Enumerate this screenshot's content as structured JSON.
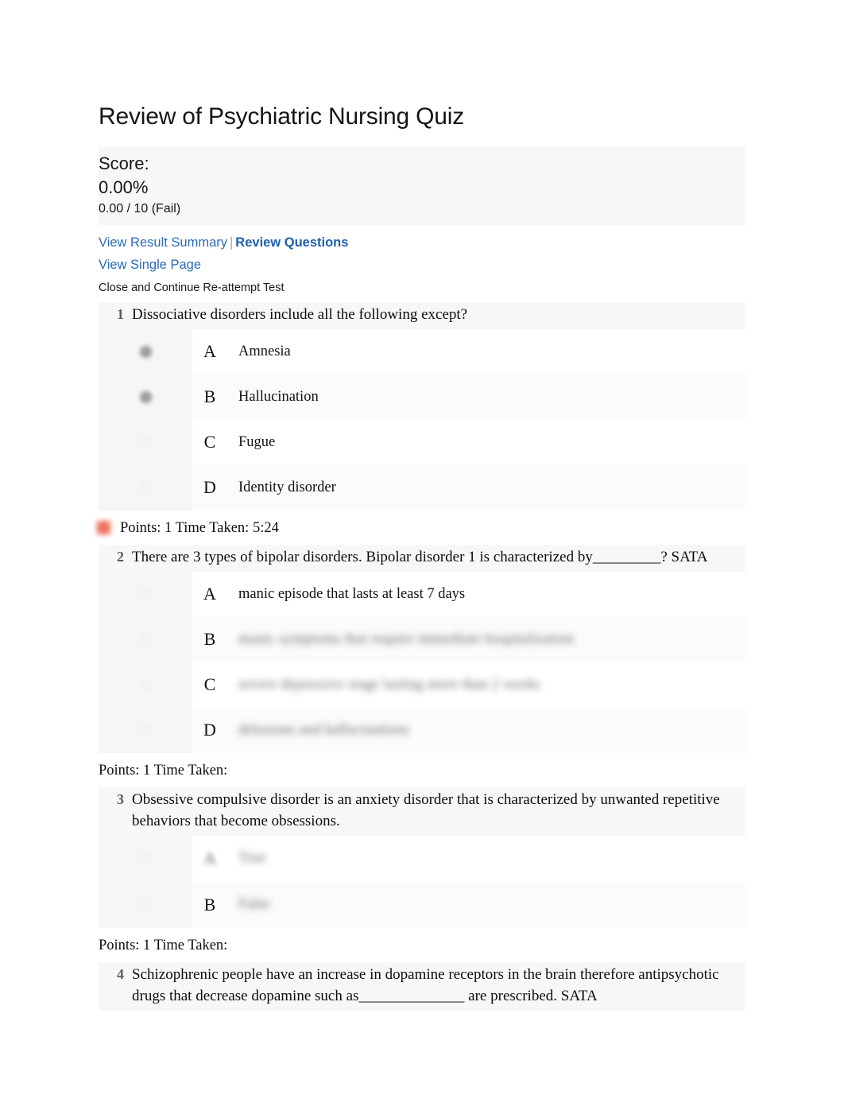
{
  "page": {
    "title": "Review of Psychiatric Nursing Quiz"
  },
  "score": {
    "label": "Score:",
    "percent": "0.00%",
    "detail": "0.00 / 10 (Fail)"
  },
  "links": {
    "view_result_summary": "View Result Summary",
    "separator": "|",
    "review_questions": "Review Questions",
    "view_single_page": "View Single Page",
    "close_and_continue": "Close and Continue Re-attempt Test"
  },
  "questions": [
    {
      "number": "1",
      "text": "Dissociative disorders include all the following except?",
      "options": [
        {
          "letter": "A",
          "text": "Amnesia",
          "blurred": false,
          "selected": true
        },
        {
          "letter": "B",
          "text": "Hallucination",
          "blurred": false,
          "selected": true
        },
        {
          "letter": "C",
          "text": "Fugue",
          "blurred": false,
          "selected": false
        },
        {
          "letter": "D",
          "text": "Identity disorder",
          "blurred": false,
          "selected": false
        }
      ],
      "points": "Points: 1 Time Taken: 5:24",
      "incorrect": true
    },
    {
      "number": "2",
      "text": "There are 3 types of bipolar disorders. Bipolar disorder 1 is characterized by_________? SATA",
      "options": [
        {
          "letter": "A",
          "text": "manic episode that lasts at least 7 days",
          "blurred": false,
          "selected": false
        },
        {
          "letter": "B",
          "text": "manic symptoms that require immediate hospitalization",
          "blurred": true,
          "selected": false
        },
        {
          "letter": "C",
          "text": "severe depressive stage lasting more than 2 weeks",
          "blurred": true,
          "selected": false
        },
        {
          "letter": "D",
          "text": "delusions and hallucinations",
          "blurred": true,
          "selected": false
        }
      ],
      "points": "Points: 1 Time Taken:",
      "incorrect": false
    },
    {
      "number": "3",
      "text": "Obsessive compulsive disorder is an anxiety disorder that is characterized by unwanted repetitive behaviors that become obsessions.",
      "options": [
        {
          "letter": "A",
          "text": "True",
          "blurred": true,
          "letter_blurred": true,
          "selected": true
        },
        {
          "letter": "B",
          "text": "False",
          "blurred": true,
          "letter_blurred": false,
          "selected": false
        }
      ],
      "points": "Points: 1 Time Taken:",
      "incorrect": false
    },
    {
      "number": "4",
      "text": "Schizophrenic people have an increase in dopamine receptors in the brain therefore antipsychotic drugs that decrease dopamine such as______________ are prescribed. SATA",
      "options": [],
      "points": "",
      "incorrect": false
    }
  ],
  "colors": {
    "link": "#2b6cb4",
    "panel_bg": "#f7f7f7",
    "incorrect_marker": "#e8563f",
    "question_number": "#5c5c5c"
  }
}
